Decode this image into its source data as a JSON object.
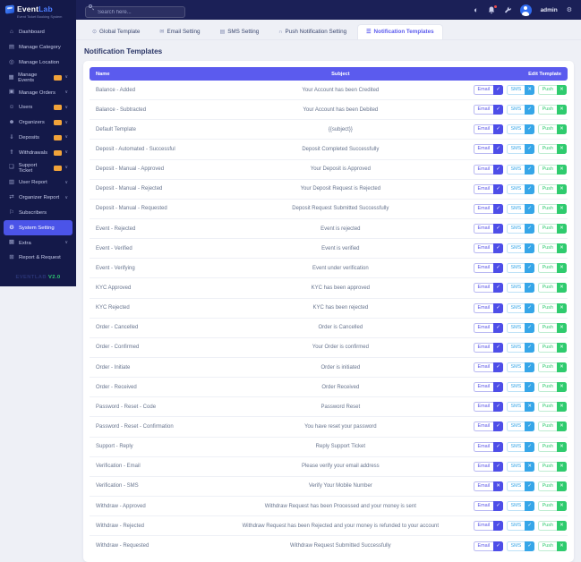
{
  "brand": {
    "name_primary": "Event",
    "name_secondary": "Lab",
    "tagline": "Event Ticket Booking System",
    "version_label": "EVENTLAB",
    "version": "V2.0"
  },
  "navbar": {
    "search_placeholder": "Search here...",
    "username": "admin",
    "theme_icon_glyph": "◐",
    "gear_icon_glyph": "⚙"
  },
  "sidebar": {
    "chevron_glyph": "∨",
    "items": [
      {
        "label": "Dashboard",
        "icon": "dashboard-icon",
        "glyph": "⌂",
        "badge": false,
        "chevron": false,
        "active": false
      },
      {
        "label": "Manage Category",
        "icon": "category-icon",
        "glyph": "▤",
        "badge": false,
        "chevron": false,
        "active": false
      },
      {
        "label": "Manage Location",
        "icon": "location-pin-icon",
        "glyph": "◎",
        "badge": false,
        "chevron": false,
        "active": false
      },
      {
        "label": "Manage Events",
        "icon": "calendar-icon",
        "glyph": "▦",
        "badge": true,
        "chevron": true,
        "active": false
      },
      {
        "label": "Manage Orders",
        "icon": "orders-icon",
        "glyph": "▣",
        "badge": false,
        "chevron": true,
        "active": false
      },
      {
        "label": "Users",
        "icon": "users-icon",
        "glyph": "☺",
        "badge": true,
        "chevron": true,
        "active": false
      },
      {
        "label": "Organizers",
        "icon": "organizers-icon",
        "glyph": "☻",
        "badge": true,
        "chevron": true,
        "active": false
      },
      {
        "label": "Deposits",
        "icon": "deposit-icon",
        "glyph": "⇓",
        "badge": true,
        "chevron": true,
        "active": false
      },
      {
        "label": "Withdrawals",
        "icon": "withdraw-icon",
        "glyph": "⇑",
        "badge": true,
        "chevron": true,
        "active": false
      },
      {
        "label": "Support Ticket",
        "icon": "support-ticket-icon",
        "glyph": "❏",
        "badge": true,
        "chevron": true,
        "active": false
      },
      {
        "label": "User Report",
        "icon": "user-report-icon",
        "glyph": "▥",
        "badge": false,
        "chevron": true,
        "active": false
      },
      {
        "label": "Organizer Report",
        "icon": "organizer-report-icon",
        "glyph": "⇄",
        "badge": false,
        "chevron": true,
        "active": false
      },
      {
        "label": "Subscribers",
        "icon": "subscribers-icon",
        "glyph": "⚐",
        "badge": false,
        "chevron": false,
        "active": false
      },
      {
        "label": "System Setting",
        "icon": "gear-icon",
        "glyph": "⚙",
        "badge": false,
        "chevron": false,
        "active": true
      },
      {
        "label": "Extra",
        "icon": "extra-icon",
        "glyph": "▩",
        "badge": false,
        "chevron": true,
        "active": false
      },
      {
        "label": "Report & Request",
        "icon": "report-request-icon",
        "glyph": "⊞",
        "badge": false,
        "chevron": false,
        "active": false
      }
    ]
  },
  "tabs": [
    {
      "label": "Global Template",
      "icon": "globe-icon",
      "glyph": "⊙",
      "active": false
    },
    {
      "label": "Email Setting",
      "icon": "envelope-icon",
      "glyph": "✉",
      "active": false
    },
    {
      "label": "SMS Setting",
      "icon": "sms-icon",
      "glyph": "▤",
      "active": false
    },
    {
      "label": "Push Notification Setting",
      "icon": "bell-icon",
      "glyph": "∩",
      "active": false
    },
    {
      "label": "Notification Templates",
      "icon": "list-icon",
      "glyph": "☰",
      "active": true
    }
  ],
  "page": {
    "title": "Notification Templates"
  },
  "table": {
    "columns": [
      "Name",
      "Subject",
      "Edit Template"
    ],
    "channel_labels": {
      "email": "Email",
      "sms": "SMS",
      "push": "Push"
    },
    "glyphs": {
      "enabled": "✓",
      "disabled": "✕"
    },
    "colors": {
      "email": "#4e4ee8",
      "sms": "#36a6e8",
      "push": "#2fcb6e",
      "header": "#5b5bee"
    },
    "rows": [
      {
        "name": "Balance - Added",
        "subject": "Your Account has been Credited",
        "email": true,
        "sms": false,
        "push": false
      },
      {
        "name": "Balance - Subtracted",
        "subject": "Your Account has been Debited",
        "email": true,
        "sms": true,
        "push": false
      },
      {
        "name": "Default Template",
        "subject": "{{subject}}",
        "email": true,
        "sms": true,
        "push": false
      },
      {
        "name": "Deposit - Automated - Successful",
        "subject": "Deposit Completed Successfully",
        "email": true,
        "sms": true,
        "push": false
      },
      {
        "name": "Deposit - Manual - Approved",
        "subject": "Your Deposit is Approved",
        "email": true,
        "sms": true,
        "push": false
      },
      {
        "name": "Deposit - Manual - Rejected",
        "subject": "Your Deposit Request is Rejected",
        "email": true,
        "sms": true,
        "push": false
      },
      {
        "name": "Deposit - Manual - Requested",
        "subject": "Deposit Request Submitted Successfully",
        "email": true,
        "sms": true,
        "push": false
      },
      {
        "name": "Event - Rejected",
        "subject": "Event is rejected",
        "email": true,
        "sms": true,
        "push": false
      },
      {
        "name": "Event - Verified",
        "subject": "Event is verified",
        "email": true,
        "sms": true,
        "push": false
      },
      {
        "name": "Event - Verifying",
        "subject": "Event under verification",
        "email": true,
        "sms": true,
        "push": false
      },
      {
        "name": "KYC Approved",
        "subject": "KYC has been approved",
        "email": true,
        "sms": true,
        "push": false
      },
      {
        "name": "KYC Rejected",
        "subject": "KYC has been rejected",
        "email": true,
        "sms": true,
        "push": false
      },
      {
        "name": "Order - Cancelled",
        "subject": "Order is Cancelled",
        "email": true,
        "sms": true,
        "push": false
      },
      {
        "name": "Order - Confirmed",
        "subject": "Your Order is confirmed",
        "email": true,
        "sms": true,
        "push": false
      },
      {
        "name": "Order - Initiate",
        "subject": "Order is initiated",
        "email": true,
        "sms": true,
        "push": false
      },
      {
        "name": "Order - Received",
        "subject": "Order Received",
        "email": true,
        "sms": true,
        "push": false
      },
      {
        "name": "Password - Reset - Code",
        "subject": "Password Reset",
        "email": true,
        "sms": false,
        "push": false
      },
      {
        "name": "Password - Reset - Confirmation",
        "subject": "You have reset your password",
        "email": true,
        "sms": true,
        "push": false
      },
      {
        "name": "Support - Reply",
        "subject": "Reply Support Ticket",
        "email": true,
        "sms": true,
        "push": false
      },
      {
        "name": "Verification - Email",
        "subject": "Please verify your email address",
        "email": true,
        "sms": false,
        "push": false
      },
      {
        "name": "Verification - SMS",
        "subject": "Verify Your Mobile Number",
        "email": false,
        "sms": true,
        "push": false
      },
      {
        "name": "Withdraw - Approved",
        "subject": "Withdraw Request has been Processed and your money is sent",
        "email": true,
        "sms": true,
        "push": false
      },
      {
        "name": "Withdraw - Rejected",
        "subject": "Withdraw Request has been Rejected and your money is refunded to your account",
        "email": true,
        "sms": true,
        "push": false
      },
      {
        "name": "Withdraw - Requested",
        "subject": "Withdraw Request Submitted Successfully",
        "email": true,
        "sms": true,
        "push": false
      }
    ]
  }
}
